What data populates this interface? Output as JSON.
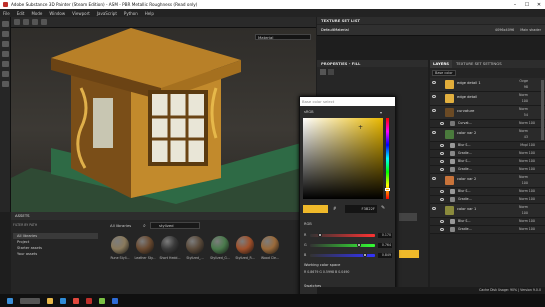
{
  "app": {
    "title": "Adobe Substance 3D Painter (Steam Edition) - ASM - PBR Metallic Roughness (Read only)",
    "window_controls": [
      "–",
      "☐",
      "✕"
    ]
  },
  "menu": [
    "File",
    "Edit",
    "Mode",
    "Window",
    "Viewport",
    "JavaScript",
    "Python",
    "Help"
  ],
  "viewport": {
    "material_mode": "Material"
  },
  "texture_set_list": {
    "title": "TEXTURE SET LIST",
    "item_name": "DefaultMaterial",
    "item_res": "4096x4096",
    "item_shader": "Main shader"
  },
  "properties": {
    "title": "PROPERTIES - FILL",
    "section": "FILL"
  },
  "layers_panel": {
    "tab_layers": "LAYERS",
    "tab_tss": "TEXTURE SET SETTINGS",
    "channel": "Base color",
    "rows": [
      {
        "name": "edge detail 1",
        "blend": "Ovge",
        "opacity": "98",
        "color": "#e2ad3a",
        "sub": false
      },
      {
        "name": "edge detail",
        "blend": "Norm",
        "opacity": "100",
        "color": "#e2b03f",
        "sub": false
      },
      {
        "name": "curvature",
        "blend": "Norm",
        "opacity": "54",
        "color": "#6b4a24",
        "sub": false
      },
      {
        "name": "Curvat...",
        "blend": "Norm",
        "opacity": "100",
        "color": "#777",
        "sub": true
      },
      {
        "name": "color var 2",
        "blend": "Norm",
        "opacity": "43",
        "color": "#4a7a3c",
        "sub": false
      },
      {
        "name": "Blur S...",
        "blend": "Mxpl",
        "opacity": "100",
        "color": "#999",
        "sub": true
      },
      {
        "name": "Gradie...",
        "blend": "Norm",
        "opacity": "100",
        "color": "#888",
        "sub": true
      },
      {
        "name": "Blur S...",
        "blend": "Norm",
        "opacity": "100",
        "color": "#999",
        "sub": true
      },
      {
        "name": "Gradie...",
        "blend": "Norm",
        "opacity": "100",
        "color": "#888",
        "sub": true
      },
      {
        "name": "color var 2",
        "blend": "Norm",
        "opacity": "100",
        "color": "#c8733a",
        "sub": false
      },
      {
        "name": "Blur S...",
        "blend": "Norm",
        "opacity": "100",
        "color": "#999",
        "sub": true
      },
      {
        "name": "Gradie...",
        "blend": "Norm",
        "opacity": "100",
        "color": "#888",
        "sub": true
      },
      {
        "name": "color var 1",
        "blend": "Norm",
        "opacity": "100",
        "color": "#8a8a3c",
        "sub": false
      },
      {
        "name": "Blur S...",
        "blend": "Norm",
        "opacity": "100",
        "color": "#999",
        "sub": true
      },
      {
        "name": "Gradie...",
        "blend": "Norm",
        "opacity": "100",
        "color": "#888",
        "sub": true
      }
    ]
  },
  "assets": {
    "title": "ASSETS",
    "filter_label": "FILTER BY PATH",
    "breadcrumb": "All libraries",
    "search_value": "stylized",
    "sidebar": [
      "All libraries",
      "Project",
      "Starter assets",
      "Your assets"
    ],
    "materials": [
      {
        "name": "Rune Styli...",
        "color": "#8a7a5c"
      },
      {
        "name": "Leather Sty...",
        "color": "#6a4a30"
      },
      {
        "name": "Short Hedd...",
        "color": "#3a3a3a"
      },
      {
        "name": "Stylized_...",
        "color": "#5a4a3a"
      },
      {
        "name": "Stylized_G...",
        "color": "#4a7a4c"
      },
      {
        "name": "Stylized_R...",
        "color": "#a0502a"
      },
      {
        "name": "Wood Cle...",
        "color": "#9a6a3a"
      }
    ]
  },
  "color_picker": {
    "search_placeholder": "Base color select",
    "mode": "sRGB",
    "hex": "F3B22F",
    "rgb_label": "RGB",
    "r": "0.170",
    "g": "0.764",
    "b": "0.849",
    "working_space_label": "Working color space",
    "working_space_values": "R 0.8679  G 0.5998  B 0.0490",
    "swatches_label": "Swatches",
    "selected_color": "#efb92a"
  },
  "status": {
    "text": "Cache Disk Usage:  90%  |  Version 9.0.0"
  }
}
